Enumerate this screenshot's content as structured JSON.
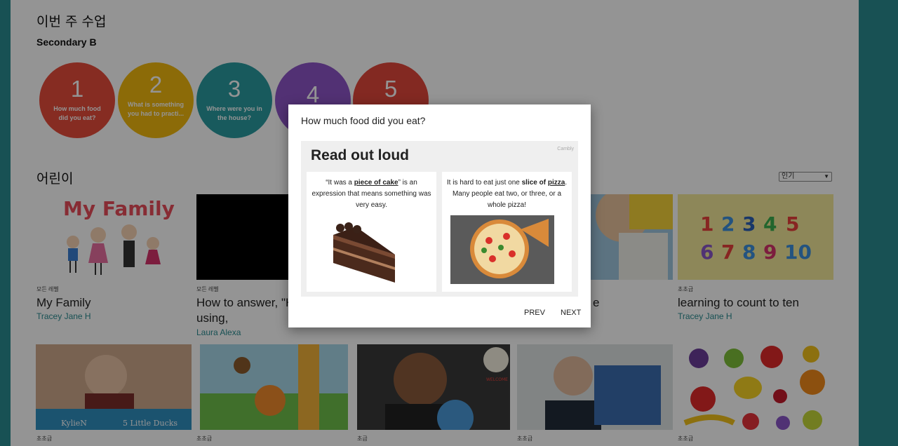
{
  "week": {
    "title": "이번 주 수업",
    "class_name": "Secondary B"
  },
  "lessons": [
    {
      "number": "1",
      "caption": "How much food did you eat?",
      "color": "#e74c3c"
    },
    {
      "number": "2",
      "caption": "What is something you had to practi...",
      "color": "#f1b80e"
    },
    {
      "number": "3",
      "caption": "Where were you in the house?",
      "color": "#2a9ba1"
    },
    {
      "number": "4",
      "caption": "",
      "color": "#8e55c9"
    },
    {
      "number": "5",
      "caption": "",
      "color": "#e2483c"
    }
  ],
  "kids": {
    "title": "어린이",
    "sort": {
      "selected": "인기"
    },
    "cards": [
      {
        "level": "모든 레벨",
        "title": "My Family",
        "author": "Tracey Jane H"
      },
      {
        "level": "모든 레벨",
        "title": "How to answer, \"H you?\". Not using,",
        "author": "Laura Alexa"
      },
      {
        "level": "",
        "title": "e",
        "author": ""
      },
      {
        "level": "초초급",
        "title": "learning to count to ten",
        "author": "Tracey Jane H"
      }
    ],
    "row2_levels": [
      "초초급",
      "초초급",
      "초급",
      "초초급",
      "초초급"
    ],
    "row2_captions": {
      "kylien": "KylieN",
      "ducks": "5 Little Ducks",
      "welcome": "WELCOME"
    },
    "family_thumb_text": "My Family",
    "count_digits": [
      "1",
      "2",
      "3",
      "4",
      "5",
      "6",
      "7",
      "8",
      "9",
      "10"
    ]
  },
  "modal": {
    "title": "How much food did you eat?",
    "slide": {
      "heading": "Read out loud",
      "watermark": "Cambly",
      "left": {
        "pre": "“It was a ",
        "bold": "piece of cake",
        "post": "” is an expression that means something was very easy."
      },
      "right": {
        "pre": "It is hard to eat just one ",
        "bold1": "slice of",
        "bold2": "pizza",
        "post": ". Many people eat two, or three, or a whole pizza!"
      }
    },
    "prev": "PREV",
    "next": "NEXT"
  }
}
